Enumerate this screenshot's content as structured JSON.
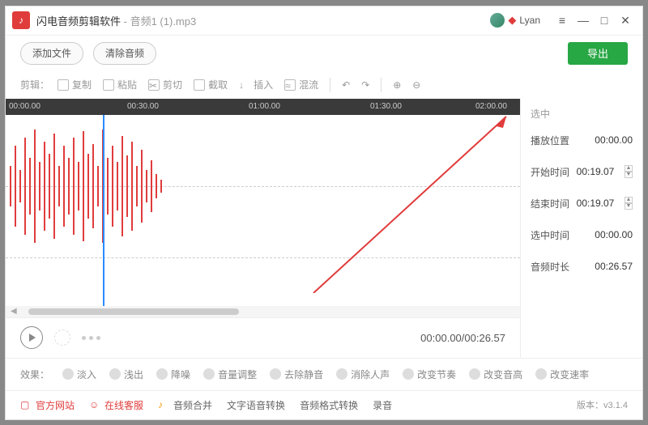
{
  "titlebar": {
    "app_name": "闪电音频剪辑软件",
    "document": "音频1 (1).mp3",
    "user": "Lyan"
  },
  "topbar": {
    "add_file": "添加文件",
    "clear_audio": "清除音频",
    "export": "导出"
  },
  "toolbar": {
    "label": "剪辑：",
    "copy": "复制",
    "paste": "粘贴",
    "cut": "剪切",
    "crop": "截取",
    "insert": "插入",
    "mix": "混流"
  },
  "timeline": {
    "t0": "00:00.00",
    "t1": "00:30.00",
    "t2": "01:00.00",
    "t3": "01:30.00",
    "t4": "02:00.00"
  },
  "player": {
    "time": "00:00.00/00:26.57"
  },
  "side": {
    "selected": "选中",
    "play_pos_label": "播放位置",
    "play_pos": "00:00.00",
    "start_label": "开始时间",
    "start": "00:19.07",
    "end_label": "结束时间",
    "end": "00:19.07",
    "sel_label": "选中时间",
    "sel": "00:00.00",
    "dur_label": "音频时长",
    "dur": "00:26.57"
  },
  "effects": {
    "label": "效果：",
    "fadein": "淡入",
    "fadeout": "浅出",
    "denoise": "降噪",
    "volume": "音量调整",
    "remove_silence": "去除静音",
    "remove_vocal": "消除人声",
    "tempo": "改变节奏",
    "pitch": "改变音高",
    "speed": "改变速率"
  },
  "footer": {
    "website": "官方网站",
    "support": "在线客服",
    "merge": "音频合并",
    "tts": "文字语音转换",
    "format": "音频格式转换",
    "record": "录音",
    "version": "版本：v3.1.4"
  }
}
